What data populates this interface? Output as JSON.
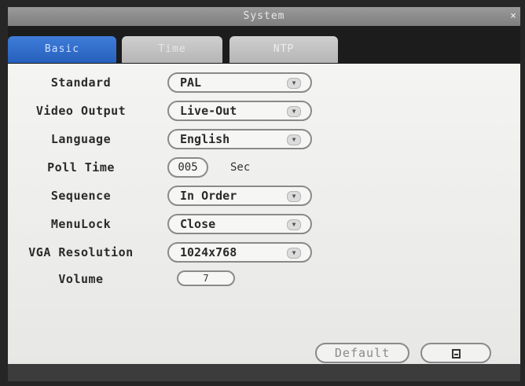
{
  "window": {
    "title": "System",
    "close_label": "×"
  },
  "tabs": [
    {
      "label": "Basic",
      "active": true
    },
    {
      "label": "Time",
      "active": false
    },
    {
      "label": "NTP",
      "active": false
    }
  ],
  "settings": {
    "standard": {
      "label": "Standard",
      "value": "PAL"
    },
    "video_output": {
      "label": "Video Output",
      "value": "Live-Out"
    },
    "language": {
      "label": "Language",
      "value": "English"
    },
    "poll_time": {
      "label": "Poll Time",
      "value": "005",
      "unit": "Sec"
    },
    "sequence": {
      "label": "Sequence",
      "value": "In Order"
    },
    "menulock": {
      "label": "MenuLock",
      "value": "Close"
    },
    "vga_resolution": {
      "label": "VGA Resolution",
      "value": "1024x768"
    },
    "volume": {
      "label": "Volume",
      "value": "7"
    }
  },
  "buttons": {
    "default_label": "Default"
  },
  "icons": {
    "dropdown": "chevron-down-icon",
    "save": "save-icon"
  },
  "colors": {
    "active_tab": "#2f6fd0",
    "panel": "#f0f0ee",
    "title": "#8a8a8a"
  }
}
